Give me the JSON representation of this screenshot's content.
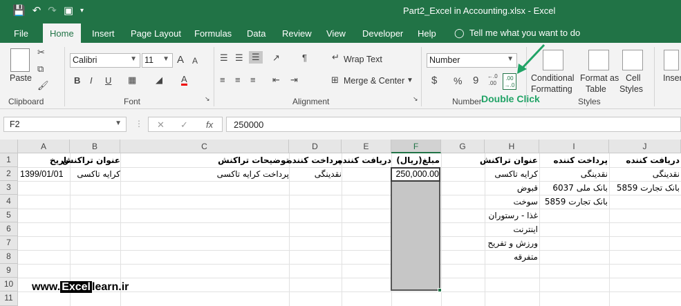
{
  "window": {
    "title": "Part2_Excel in Accounting.xlsx  -  Excel",
    "qat_icons": [
      "save-icon",
      "undo-icon",
      "redo-icon",
      "camera-icon",
      "customize-qat-icon"
    ]
  },
  "tabs": [
    "File",
    "Home",
    "Insert",
    "Page Layout",
    "Formulas",
    "Data",
    "Review",
    "View",
    "Developer",
    "Help"
  ],
  "active_tab": "Home",
  "tell_me": "Tell me what you want to do",
  "ribbon": {
    "clipboard": {
      "paste": "Paste",
      "label": "Clipboard"
    },
    "font": {
      "name": "Calibri",
      "size": "11",
      "bold": "B",
      "italic": "I",
      "underline": "U",
      "grow": "A",
      "shrink": "A",
      "label": "Font"
    },
    "alignment": {
      "wrap_text": "Wrap Text",
      "merge_center": "Merge & Center",
      "label": "Alignment"
    },
    "number": {
      "format": "Number",
      "currency": "$",
      "percent": "%",
      "comma": "9",
      "dec_increase": "←.0\n.00",
      "dec_decrease": ".00\n→.0",
      "label": "Number"
    },
    "styles": {
      "conditional_1": "Conditional",
      "conditional_2": "Formatting",
      "format_as_1": "Format as",
      "format_as_2": "Table",
      "cell_styles_1": "Cell",
      "cell_styles_2": "Styles",
      "label": "Styles"
    },
    "insert": "Inser",
    "annotation": "Double Click"
  },
  "formula_bar": {
    "name_box": "F2",
    "fx": "fx",
    "value": "250000"
  },
  "columns": [
    "A",
    "B",
    "C",
    "D",
    "E",
    "F",
    "G",
    "H",
    "I",
    "J"
  ],
  "rows": [
    "1",
    "2",
    "3",
    "4",
    "5",
    "6",
    "7",
    "8",
    "9",
    "10",
    "11"
  ],
  "cells": {
    "A1": "تاریخ",
    "B1": "عنوان تراکنش",
    "C1": "توضیحات تراکنش",
    "D1": "پرداخت کننده",
    "E1": "دریافت کننده",
    "F1": "مبلغ(ریال)",
    "H1": "عنوان تراکنش",
    "I1": "پرداخت کننده",
    "J1": "دریافت کننده",
    "A2": "1399/01/01",
    "B2": "کرایه تاکسی",
    "C2": "پرداخت کرایه تاکسی",
    "D2": "نقدینگی",
    "F2": "250,000.00",
    "H2": "کرایه تاکسی",
    "I2": "نقدینگی",
    "J2": "نقدینگی",
    "H3": "قبوض",
    "I3": "بانک ملی 6037",
    "J3": "بانک تجارت 5859",
    "H4": "سوخت",
    "I4": "بانک تجارت 5859",
    "H5": "غذا - رستوران",
    "H6": "اینترنت",
    "H7": "ورزش و تفریح",
    "H8": "متفرقه"
  },
  "selection": {
    "active": "F2",
    "range": "F2:F10"
  },
  "watermark": {
    "prefix": "www.",
    "highlight": "Excel",
    "suffix": "learn.ir"
  },
  "colors": {
    "excel_green": "#217346",
    "annotation_green": "#21a366"
  }
}
